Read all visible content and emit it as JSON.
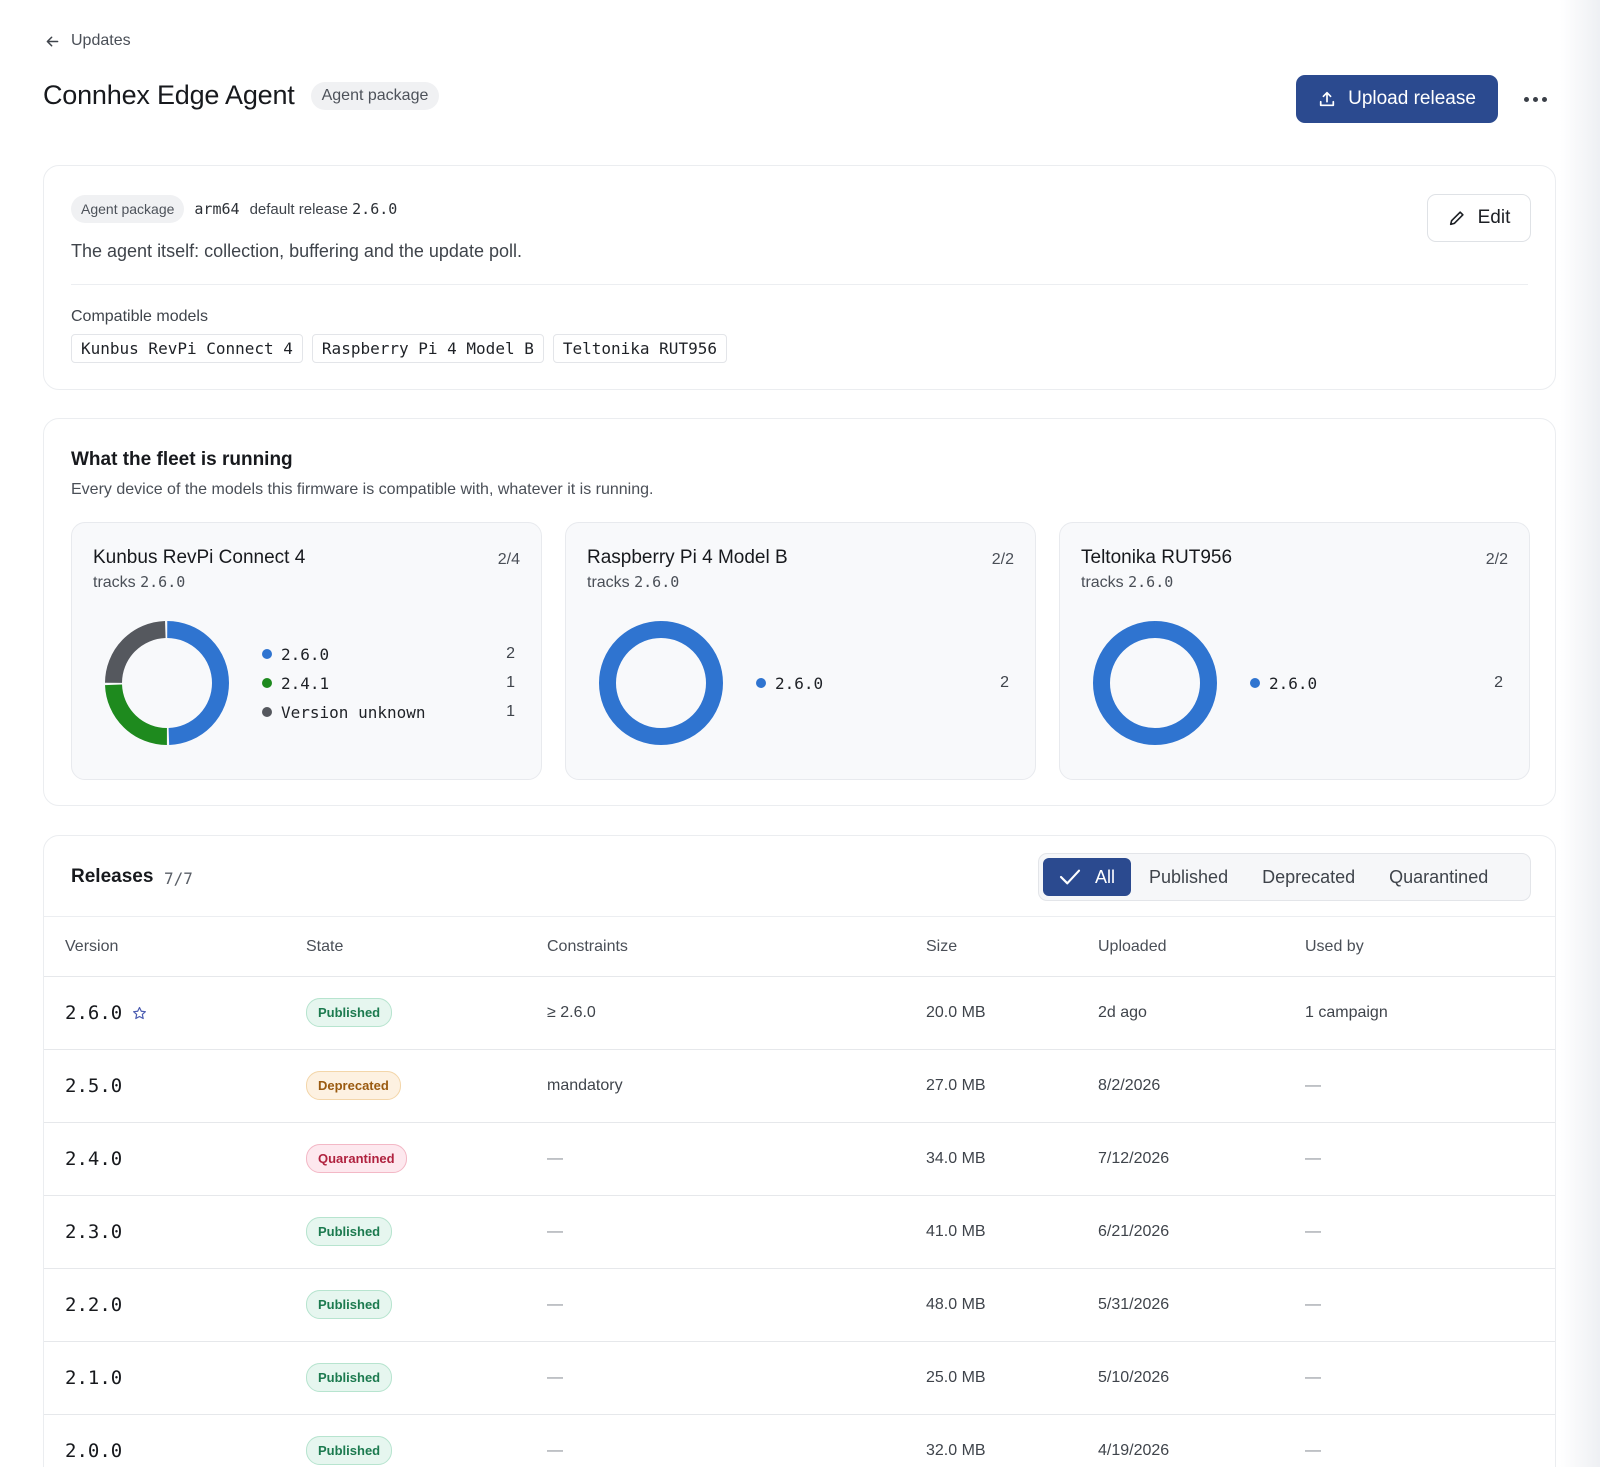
{
  "nav": {
    "back_label": "Updates"
  },
  "header": {
    "title": "Connhex Edge Agent",
    "type_pill": "Agent package",
    "upload_label": "Upload release"
  },
  "summary": {
    "type_pill": "Agent package",
    "arch": "arm64",
    "default_label": "default release",
    "default_version": "2.6.0",
    "description": "The agent itself: collection, buffering and the update poll.",
    "edit_label": "Edit",
    "compat_label": "Compatible models",
    "compatible_models": [
      "Kunbus RevPi Connect 4",
      "Raspberry Pi 4 Model B",
      "Teltonika RUT956"
    ]
  },
  "fleet": {
    "title": "What the fleet is running",
    "subtitle": "Every device of the models this firmware is compatible with, whatever it is running.",
    "cards": [
      {
        "model": "Kunbus RevPi Connect 4",
        "ratio": "2/4",
        "tracks_label": "tracks",
        "tracks_version": "2.6.0",
        "legend": [
          {
            "label": "2.6.0",
            "count": 2,
            "color": "#2f74d0"
          },
          {
            "label": "2.4.1",
            "count": 1,
            "color": "#1e8a1e"
          },
          {
            "label": "Version unknown",
            "count": 1,
            "color": "#55585e"
          }
        ]
      },
      {
        "model": "Raspberry Pi 4 Model B",
        "ratio": "2/2",
        "tracks_label": "tracks",
        "tracks_version": "2.6.0",
        "legend": [
          {
            "label": "2.6.0",
            "count": 2,
            "color": "#2f74d0"
          }
        ]
      },
      {
        "model": "Teltonika RUT956",
        "ratio": "2/2",
        "tracks_label": "tracks",
        "tracks_version": "2.6.0",
        "legend": [
          {
            "label": "2.6.0",
            "count": 2,
            "color": "#2f74d0"
          }
        ]
      }
    ]
  },
  "releases": {
    "title": "Releases",
    "count": "7/7",
    "filters": [
      "All",
      "Published",
      "Deprecated",
      "Quarantined"
    ],
    "active_filter": "All",
    "columns": [
      "Version",
      "State",
      "Constraints",
      "Size",
      "Uploaded",
      "Used by"
    ],
    "rows": [
      {
        "version": "2.6.0",
        "default": true,
        "state": "Published",
        "constraints": "≥ 2.6.0",
        "size": "20.0 MB",
        "uploaded": "2d ago",
        "used_by": "1 campaign"
      },
      {
        "version": "2.5.0",
        "default": false,
        "state": "Deprecated",
        "constraints": "mandatory",
        "size": "27.0 MB",
        "uploaded": "8/2/2026",
        "used_by": "—"
      },
      {
        "version": "2.4.0",
        "default": false,
        "state": "Quarantined",
        "constraints": "—",
        "size": "34.0 MB",
        "uploaded": "7/12/2026",
        "used_by": "—"
      },
      {
        "version": "2.3.0",
        "default": false,
        "state": "Published",
        "constraints": "—",
        "size": "41.0 MB",
        "uploaded": "6/21/2026",
        "used_by": "—"
      },
      {
        "version": "2.2.0",
        "default": false,
        "state": "Published",
        "constraints": "—",
        "size": "48.0 MB",
        "uploaded": "5/31/2026",
        "used_by": "—"
      },
      {
        "version": "2.1.0",
        "default": false,
        "state": "Published",
        "constraints": "—",
        "size": "25.0 MB",
        "uploaded": "5/10/2026",
        "used_by": "—"
      },
      {
        "version": "2.0.0",
        "default": false,
        "state": "Published",
        "constraints": "—",
        "size": "32.0 MB",
        "uploaded": "4/19/2026",
        "used_by": "—"
      }
    ]
  },
  "icons": {
    "back": "arrow-left-icon",
    "upload": "upload-icon",
    "more": "more-horizontal-icon",
    "edit": "pencil-icon",
    "check": "check-icon",
    "default_star": "star-icon"
  }
}
